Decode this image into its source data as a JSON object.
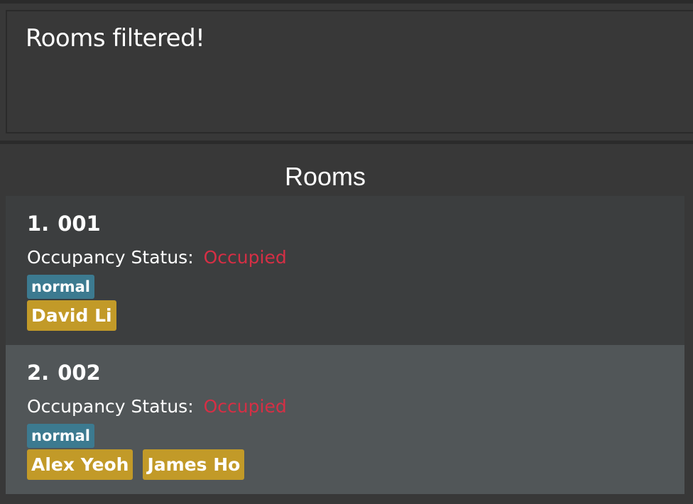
{
  "result_display": {
    "message": "Rooms filtered!"
  },
  "rooms_panel": {
    "heading": "Rooms",
    "rooms": [
      {
        "index": "1.",
        "number": "001",
        "status_label": "Occupancy Status:",
        "status_value": "Occupied",
        "type_tag": "normal",
        "guests": [
          "David Li"
        ]
      },
      {
        "index": "2.",
        "number": "002",
        "status_label": "Occupancy Status:",
        "status_value": "Occupied",
        "type_tag": "normal",
        "guests": [
          "Alex Yeoh",
          "James Ho"
        ]
      }
    ]
  },
  "colors": {
    "background": "#383838",
    "status_occupied": "#d62f45",
    "type_tag": "#3c7a90",
    "guest_tag": "#c29a28",
    "card_odd": "#3c3e3f",
    "card_selected": "#515658"
  }
}
